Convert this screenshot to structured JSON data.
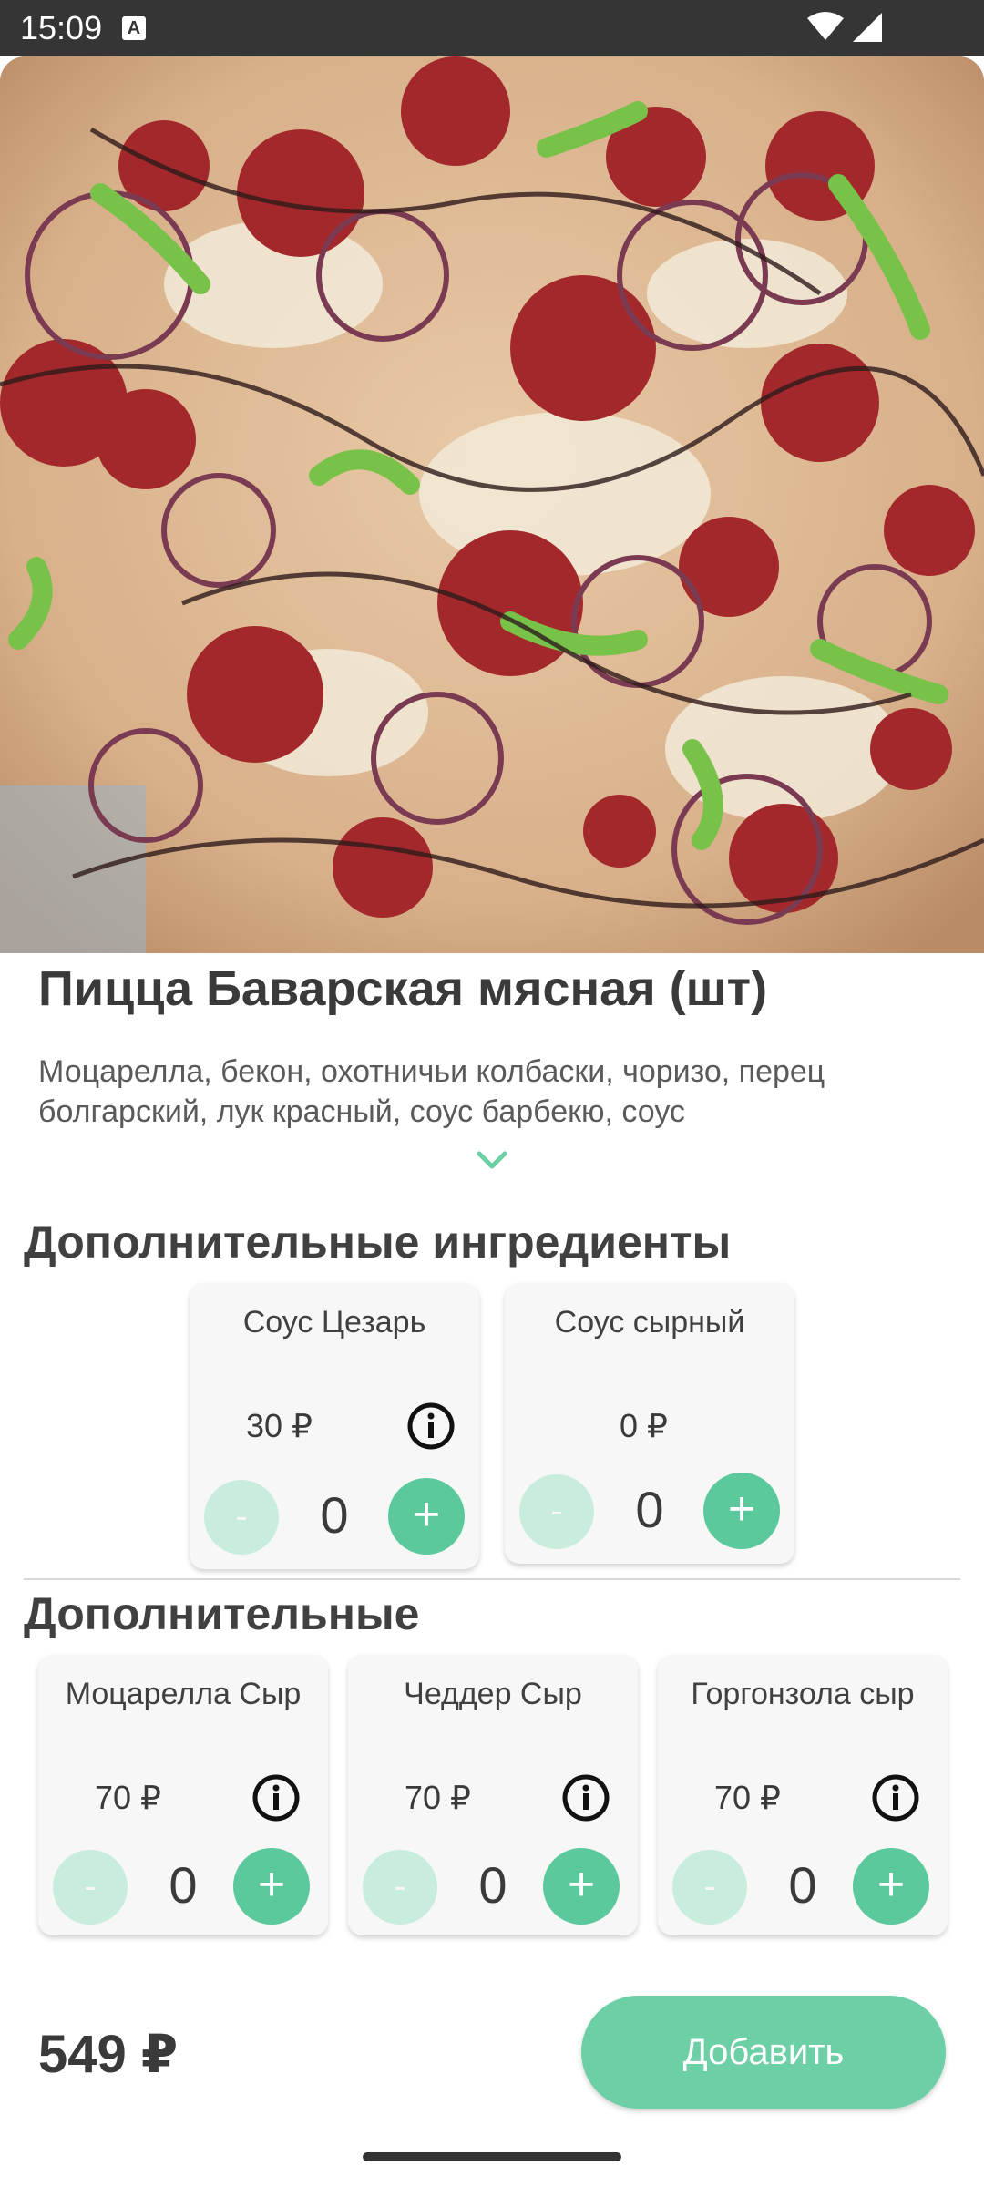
{
  "status_bar": {
    "time": "15:09",
    "a_badge": "A"
  },
  "product": {
    "title": "Пицца Баварская мясная (шт)",
    "description_line1": "Моцарелла, бекон, охотничьи колбаски, чоризо, перец",
    "description_line2": "болгарский, лук красный, соус барбекю, соус"
  },
  "section1": {
    "title": "Дополнительные ингредиенты",
    "items": [
      {
        "name": "Соус Цезарь",
        "price": "30 ₽",
        "qty": "0",
        "minus": "-",
        "plus": "+"
      },
      {
        "name": "Соус сырный",
        "price": "0 ₽",
        "qty": "0",
        "minus": "-",
        "plus": "+"
      }
    ]
  },
  "section2": {
    "title": "Дополнительные",
    "items": [
      {
        "name": "Моцарелла Сыр",
        "price": "70 ₽",
        "qty": "0",
        "minus": "-",
        "plus": "+"
      },
      {
        "name": "Чеддер Сыр",
        "price": "70 ₽",
        "qty": "0",
        "minus": "-",
        "plus": "+"
      },
      {
        "name": "Горгонзола сыр",
        "price": "70 ₽",
        "qty": "0",
        "minus": "-",
        "plus": "+"
      }
    ]
  },
  "footer": {
    "total": "549 ₽",
    "add_label": "Добавить"
  },
  "colors": {
    "accent": "#5bc99c",
    "accent_light": "#c8eddd",
    "status_bar": "#353535"
  },
  "icons": {
    "info": "info-icon",
    "expand": "chevron-down-icon",
    "wifi": "wifi-icon",
    "signal": "signal-icon"
  }
}
